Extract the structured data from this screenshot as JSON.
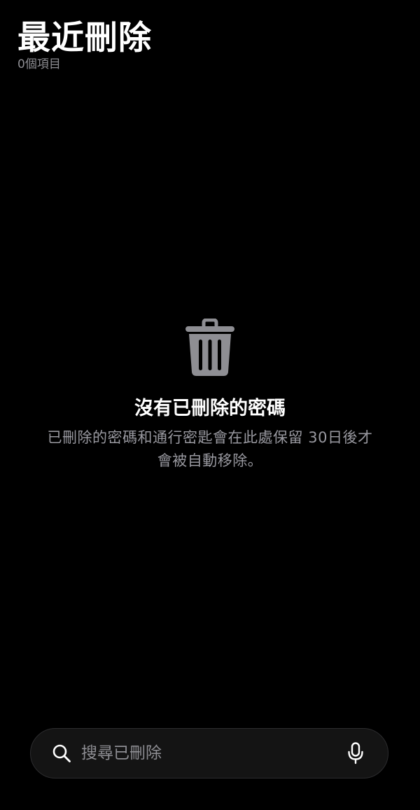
{
  "header": {
    "title": "最近刪除",
    "item_count": "0個項目"
  },
  "empty_state": {
    "icon": "trash-icon",
    "title": "沒有已刪除的密碼",
    "description": "已刪除的密碼和通行密匙會在此處保留 30日後才會被自動移除。"
  },
  "search": {
    "placeholder": "搜尋已刪除",
    "value": "",
    "search_icon": "search-icon",
    "mic_icon": "microphone-icon"
  },
  "colors": {
    "background": "#000000",
    "primary_text": "#ffffff",
    "secondary_text": "#8e8e93",
    "icon_gray": "#8e8e93",
    "search_background": "#141414"
  }
}
